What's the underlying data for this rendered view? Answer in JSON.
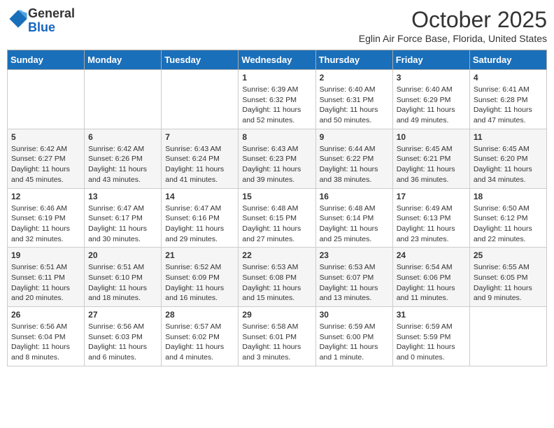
{
  "header": {
    "logo_line1": "General",
    "logo_line2": "Blue",
    "title": "October 2025",
    "subtitle": "Eglin Air Force Base, Florida, United States"
  },
  "weekdays": [
    "Sunday",
    "Monday",
    "Tuesday",
    "Wednesday",
    "Thursday",
    "Friday",
    "Saturday"
  ],
  "weeks": [
    [
      {
        "day": "",
        "info": ""
      },
      {
        "day": "",
        "info": ""
      },
      {
        "day": "",
        "info": ""
      },
      {
        "day": "1",
        "info": "Sunrise: 6:39 AM\nSunset: 6:32 PM\nDaylight: 11 hours\nand 52 minutes."
      },
      {
        "day": "2",
        "info": "Sunrise: 6:40 AM\nSunset: 6:31 PM\nDaylight: 11 hours\nand 50 minutes."
      },
      {
        "day": "3",
        "info": "Sunrise: 6:40 AM\nSunset: 6:29 PM\nDaylight: 11 hours\nand 49 minutes."
      },
      {
        "day": "4",
        "info": "Sunrise: 6:41 AM\nSunset: 6:28 PM\nDaylight: 11 hours\nand 47 minutes."
      }
    ],
    [
      {
        "day": "5",
        "info": "Sunrise: 6:42 AM\nSunset: 6:27 PM\nDaylight: 11 hours\nand 45 minutes."
      },
      {
        "day": "6",
        "info": "Sunrise: 6:42 AM\nSunset: 6:26 PM\nDaylight: 11 hours\nand 43 minutes."
      },
      {
        "day": "7",
        "info": "Sunrise: 6:43 AM\nSunset: 6:24 PM\nDaylight: 11 hours\nand 41 minutes."
      },
      {
        "day": "8",
        "info": "Sunrise: 6:43 AM\nSunset: 6:23 PM\nDaylight: 11 hours\nand 39 minutes."
      },
      {
        "day": "9",
        "info": "Sunrise: 6:44 AM\nSunset: 6:22 PM\nDaylight: 11 hours\nand 38 minutes."
      },
      {
        "day": "10",
        "info": "Sunrise: 6:45 AM\nSunset: 6:21 PM\nDaylight: 11 hours\nand 36 minutes."
      },
      {
        "day": "11",
        "info": "Sunrise: 6:45 AM\nSunset: 6:20 PM\nDaylight: 11 hours\nand 34 minutes."
      }
    ],
    [
      {
        "day": "12",
        "info": "Sunrise: 6:46 AM\nSunset: 6:19 PM\nDaylight: 11 hours\nand 32 minutes."
      },
      {
        "day": "13",
        "info": "Sunrise: 6:47 AM\nSunset: 6:17 PM\nDaylight: 11 hours\nand 30 minutes."
      },
      {
        "day": "14",
        "info": "Sunrise: 6:47 AM\nSunset: 6:16 PM\nDaylight: 11 hours\nand 29 minutes."
      },
      {
        "day": "15",
        "info": "Sunrise: 6:48 AM\nSunset: 6:15 PM\nDaylight: 11 hours\nand 27 minutes."
      },
      {
        "day": "16",
        "info": "Sunrise: 6:48 AM\nSunset: 6:14 PM\nDaylight: 11 hours\nand 25 minutes."
      },
      {
        "day": "17",
        "info": "Sunrise: 6:49 AM\nSunset: 6:13 PM\nDaylight: 11 hours\nand 23 minutes."
      },
      {
        "day": "18",
        "info": "Sunrise: 6:50 AM\nSunset: 6:12 PM\nDaylight: 11 hours\nand 22 minutes."
      }
    ],
    [
      {
        "day": "19",
        "info": "Sunrise: 6:51 AM\nSunset: 6:11 PM\nDaylight: 11 hours\nand 20 minutes."
      },
      {
        "day": "20",
        "info": "Sunrise: 6:51 AM\nSunset: 6:10 PM\nDaylight: 11 hours\nand 18 minutes."
      },
      {
        "day": "21",
        "info": "Sunrise: 6:52 AM\nSunset: 6:09 PM\nDaylight: 11 hours\nand 16 minutes."
      },
      {
        "day": "22",
        "info": "Sunrise: 6:53 AM\nSunset: 6:08 PM\nDaylight: 11 hours\nand 15 minutes."
      },
      {
        "day": "23",
        "info": "Sunrise: 6:53 AM\nSunset: 6:07 PM\nDaylight: 11 hours\nand 13 minutes."
      },
      {
        "day": "24",
        "info": "Sunrise: 6:54 AM\nSunset: 6:06 PM\nDaylight: 11 hours\nand 11 minutes."
      },
      {
        "day": "25",
        "info": "Sunrise: 6:55 AM\nSunset: 6:05 PM\nDaylight: 11 hours\nand 9 minutes."
      }
    ],
    [
      {
        "day": "26",
        "info": "Sunrise: 6:56 AM\nSunset: 6:04 PM\nDaylight: 11 hours\nand 8 minutes."
      },
      {
        "day": "27",
        "info": "Sunrise: 6:56 AM\nSunset: 6:03 PM\nDaylight: 11 hours\nand 6 minutes."
      },
      {
        "day": "28",
        "info": "Sunrise: 6:57 AM\nSunset: 6:02 PM\nDaylight: 11 hours\nand 4 minutes."
      },
      {
        "day": "29",
        "info": "Sunrise: 6:58 AM\nSunset: 6:01 PM\nDaylight: 11 hours\nand 3 minutes."
      },
      {
        "day": "30",
        "info": "Sunrise: 6:59 AM\nSunset: 6:00 PM\nDaylight: 11 hours\nand 1 minute."
      },
      {
        "day": "31",
        "info": "Sunrise: 6:59 AM\nSunset: 5:59 PM\nDaylight: 11 hours\nand 0 minutes."
      },
      {
        "day": "",
        "info": ""
      }
    ]
  ]
}
